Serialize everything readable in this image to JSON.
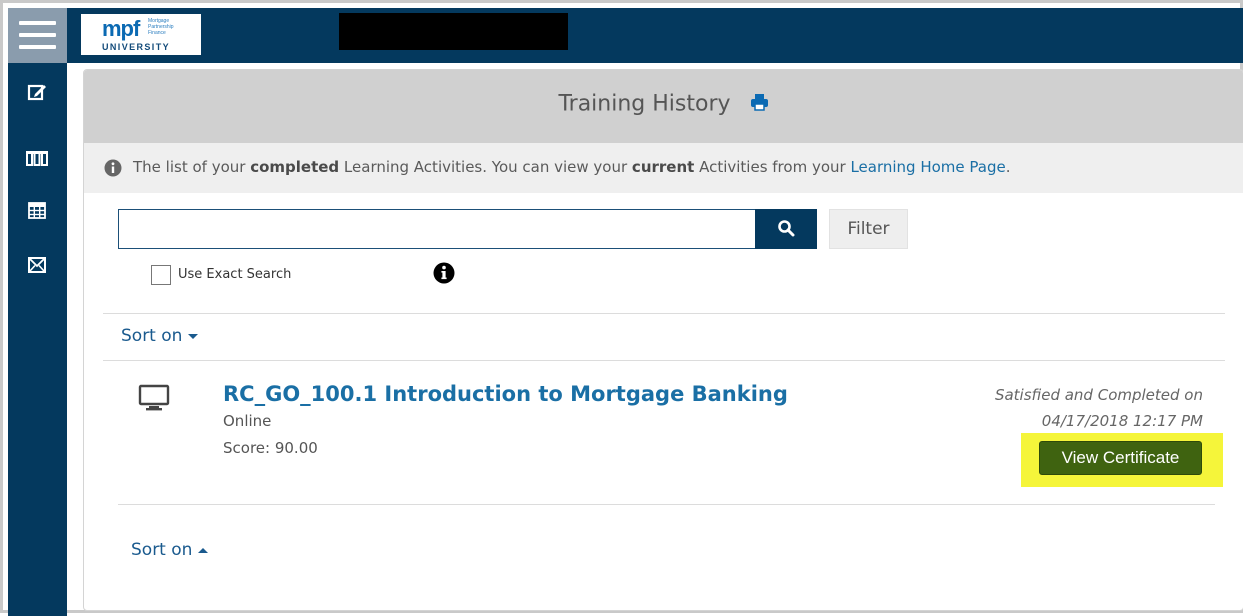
{
  "app": {
    "logo_text": "mpf",
    "logo_tagline": "Mortgage Partnership Finance",
    "logo_subtitle": "UNIVERSITY"
  },
  "sidebar": {
    "items": [
      {
        "icon": "edit-icon"
      },
      {
        "icon": "catalog-icon"
      },
      {
        "icon": "calendar-icon"
      },
      {
        "icon": "mail-icon"
      }
    ]
  },
  "page": {
    "title": "Training History",
    "print_icon": "print-icon"
  },
  "info_bar": {
    "text_1": "The list of your ",
    "bold_1": "completed",
    "text_2": " Learning Activities. You can view your ",
    "bold_2": "current",
    "text_3": " Activities from your ",
    "link": "Learning Home Page",
    "text_4": "."
  },
  "search": {
    "value": "",
    "placeholder": "",
    "filter_label": "Filter",
    "exact_search_label": "Use Exact Search",
    "exact_search_checked": false
  },
  "sort": {
    "top_label": "Sort on",
    "bottom_label": "Sort on"
  },
  "activities": [
    {
      "title": "RC_GO_100.1 Introduction to Mortgage Banking",
      "type": "Online",
      "score": "Score: 90.00",
      "status": "Satisfied and Completed on",
      "completed_at": "04/17/2018 12:17 PM",
      "action_label": "View Certificate"
    }
  ],
  "colors": {
    "nav_bg": "#04395e",
    "link": "#1a6fa5",
    "certificate_button": "#3f6310",
    "highlight": "#f5f53a"
  }
}
